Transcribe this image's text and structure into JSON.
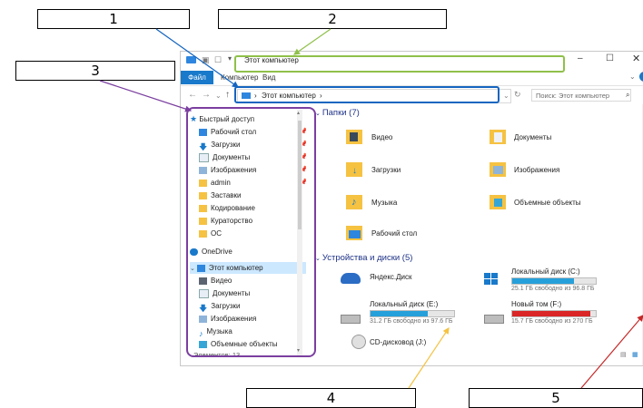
{
  "callouts": {
    "c1": "1",
    "c2": "2",
    "c3": "3",
    "c4": "4",
    "c5": "5"
  },
  "window": {
    "title": "Этот компьютер",
    "tabs": {
      "file": "Файл",
      "computer": "Компьютер",
      "view": "Вид"
    },
    "address": "Этот компьютер",
    "search_placeholder": "Поиск: Этот компьютер"
  },
  "sidebar": {
    "quick_access": "Быстрый доступ",
    "quick_items": [
      "Рабочий стол",
      "Загрузки",
      "Документы",
      "Изображения",
      "admin",
      "Заставки",
      "Кодирование",
      "Кураторство",
      "ОС"
    ],
    "onedrive": "OneDrive",
    "this_pc": "Этот компьютер",
    "pc_items": [
      "Видео",
      "Документы",
      "Загрузки",
      "Изображения",
      "Музыка",
      "Объемные объекты"
    ],
    "status": "Элементов: 13"
  },
  "folders": {
    "header": "Папки (7)",
    "items": [
      "Видео",
      "Документы",
      "Загрузки",
      "Изображения",
      "Музыка",
      "Объемные объекты",
      "Рабочий стол"
    ]
  },
  "devices": {
    "header": "Устройства и диски (5)",
    "yandex": "Яндекс.Диск",
    "drive_c": {
      "label": "Локальный диск (C:)",
      "free": "25.1 ГБ свободно из 96.8 ГБ",
      "used": 0.74
    },
    "drive_e": {
      "label": "Локальный диск (E:)",
      "free": "31.2 ГБ свободно из 97.6 ГБ",
      "used": 0.68
    },
    "drive_f": {
      "label": "Новый том (F:)",
      "free": "15.7 ГБ свободно из 270 ГБ",
      "used": 0.94
    },
    "cd": "CD-дисковод (J:)"
  },
  "colors": {
    "accent": "#1979ca",
    "green": "#8fc04a",
    "blue": "#1565c0",
    "purple": "#7b3fa0",
    "yellow": "#f5c242",
    "red": "#c62828",
    "drive_normal": "#26a0da",
    "drive_full": "#da2626"
  }
}
